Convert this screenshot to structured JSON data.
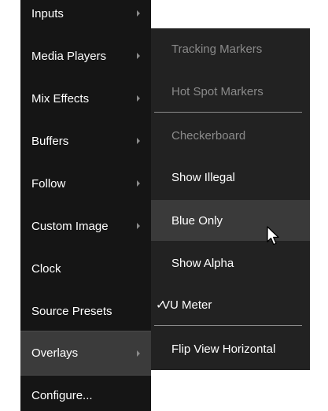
{
  "main_menu": {
    "items": [
      {
        "label": "Inputs",
        "has_submenu": true,
        "selected": false
      },
      {
        "label": "Media Players",
        "has_submenu": true,
        "selected": false
      },
      {
        "label": "Mix Effects",
        "has_submenu": true,
        "selected": false
      },
      {
        "label": "Buffers",
        "has_submenu": true,
        "selected": false
      },
      {
        "label": "Follow",
        "has_submenu": true,
        "selected": false
      },
      {
        "label": "Custom Image",
        "has_submenu": true,
        "selected": false
      },
      {
        "label": "Clock",
        "has_submenu": false,
        "selected": false
      },
      {
        "label": "Source Presets",
        "has_submenu": false,
        "selected": false
      },
      {
        "label": "Overlays",
        "has_submenu": true,
        "selected": true
      },
      {
        "label": "Configure...",
        "has_submenu": false,
        "selected": false
      }
    ]
  },
  "overlays_submenu": {
    "items": [
      {
        "label": "Tracking Markers",
        "enabled": false,
        "checked": false,
        "hovered": false
      },
      {
        "label": "Hot Spot Markers",
        "enabled": false,
        "checked": false,
        "hovered": false
      },
      {
        "label": "Checkerboard",
        "enabled": false,
        "checked": false,
        "hovered": false
      },
      {
        "label": "Show Illegal",
        "enabled": true,
        "checked": false,
        "hovered": false
      },
      {
        "label": "Blue Only",
        "enabled": true,
        "checked": false,
        "hovered": true
      },
      {
        "label": "Show Alpha",
        "enabled": true,
        "checked": false,
        "hovered": false
      },
      {
        "label": "VU Meter",
        "enabled": true,
        "checked": true,
        "hovered": false
      },
      {
        "label": "Flip View Horizontal",
        "enabled": true,
        "checked": false,
        "hovered": false
      }
    ],
    "check_mark": "✓"
  },
  "icons": {
    "submenu_arrow": "chevron-right-icon",
    "check": "check-icon",
    "cursor": "mouse-pointer-icon"
  },
  "colors": {
    "main_menu_bg": "#151515",
    "submenu_bg": "#222222",
    "selected_bg": "#3b3b3b",
    "hover_bg": "#3a3a3a",
    "text": "#ffffff",
    "disabled_text": "#8a8a8a"
  }
}
